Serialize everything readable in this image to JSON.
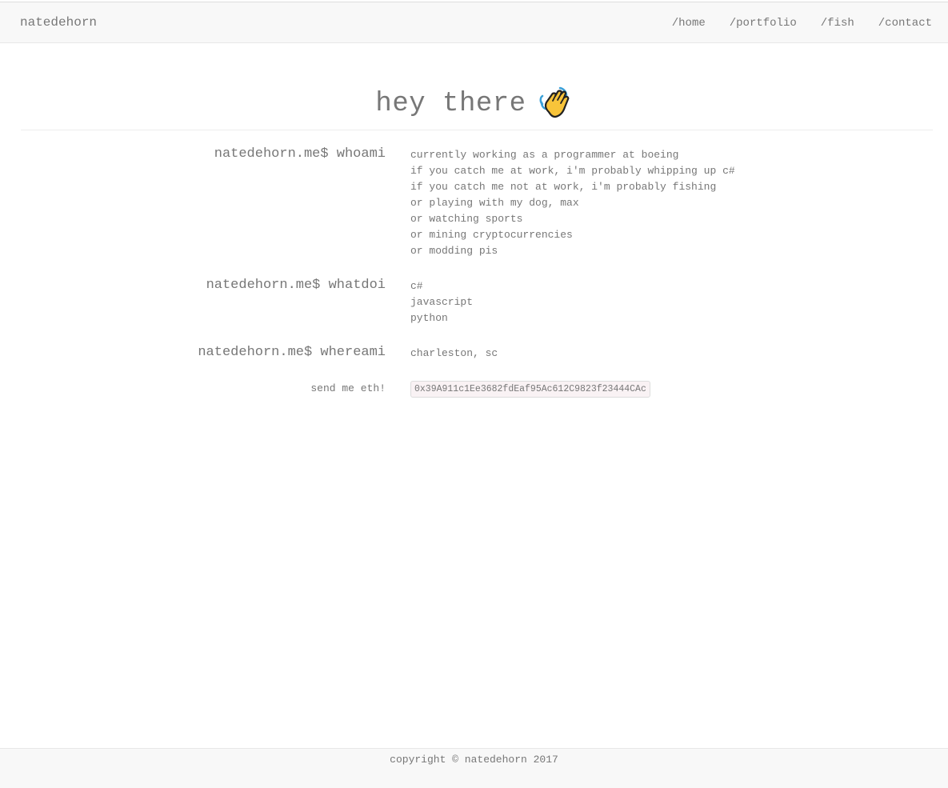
{
  "navbar": {
    "brand": "natedehorn",
    "links": [
      "/home",
      "/portfolio",
      "/fish",
      "/contact"
    ]
  },
  "hero": {
    "title": "hey there",
    "icon": "waving-hand-icon"
  },
  "sections": [
    {
      "prompt": "natedehorn.me$ whoami",
      "lines": [
        "currently working as a programmer at boeing",
        "if you catch me at work, i'm probably whipping up c#",
        "if you catch me not at work, i'm probably fishing",
        "or playing with my dog, max",
        "or watching sports",
        "or mining cryptocurrencies",
        "or modding pis"
      ]
    },
    {
      "prompt": "natedehorn.me$ whatdoi",
      "lines": [
        "c#",
        "javascript",
        "python"
      ]
    },
    {
      "prompt": "natedehorn.me$ whereami",
      "lines": [
        "charleston, sc"
      ]
    }
  ],
  "eth": {
    "label": "send me eth!",
    "address": "0x39A911c1Ee3682fdEaf95Ac612C9823f23444CAc"
  },
  "footer": {
    "text": "copyright © natedehorn 2017"
  },
  "colors": {
    "text": "#777777",
    "navbar_bg": "#f8f8f8",
    "code_bg": "#f9f2f4"
  }
}
